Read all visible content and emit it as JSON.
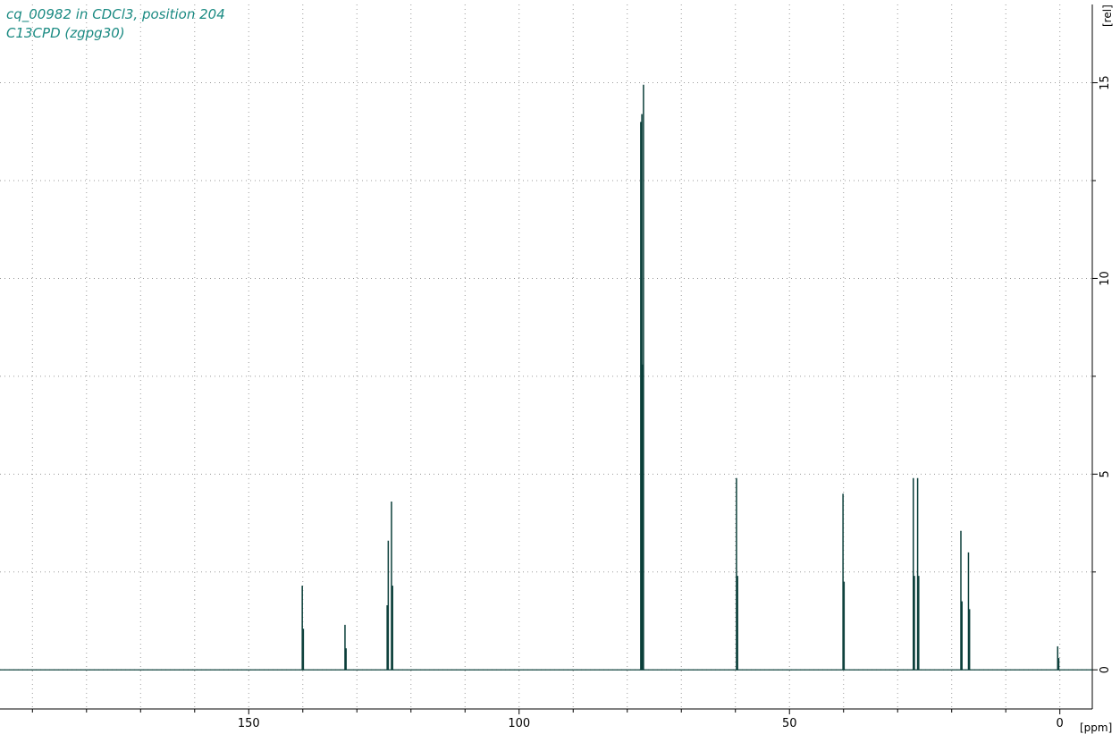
{
  "window": {
    "title_line1": "cq_00982 in CDCl3, position 204",
    "title_line2": "C13CPD (zgpg30)"
  },
  "colors": {
    "title": "#1a8a82",
    "spectrum": "#0b3f3a",
    "grid": "#9a9a9a",
    "background": "#ffffff"
  },
  "chart_data": {
    "type": "line",
    "title": "cq_00982 in CDCl3, position 204",
    "subtitle": "C13CPD (zgpg30)",
    "xlabel": "[ppm]",
    "ylabel": "[rel]",
    "x_reversed": true,
    "xlim": [
      196,
      -6
    ],
    "ylim": [
      -1,
      17
    ],
    "x_ticks": [
      150,
      100,
      50,
      0
    ],
    "y_ticks": [
      0,
      5,
      10,
      15
    ],
    "grid": true,
    "peaks": [
      {
        "ppm": 140.1,
        "height": 2.15
      },
      {
        "ppm": 139.9,
        "height": 1.05
      },
      {
        "ppm": 132.2,
        "height": 1.15
      },
      {
        "ppm": 132.0,
        "height": 0.55
      },
      {
        "ppm": 124.4,
        "height": 1.65
      },
      {
        "ppm": 124.2,
        "height": 3.3
      },
      {
        "ppm": 123.6,
        "height": 4.3
      },
      {
        "ppm": 123.4,
        "height": 2.15
      },
      {
        "ppm": 77.5,
        "height": 14.0
      },
      {
        "ppm": 77.3,
        "height": 14.2
      },
      {
        "ppm": 77.2,
        "height": 7.8
      },
      {
        "ppm": 77.0,
        "height": 14.95
      },
      {
        "ppm": 59.8,
        "height": 4.9
      },
      {
        "ppm": 59.6,
        "height": 2.4
      },
      {
        "ppm": 40.1,
        "height": 4.5
      },
      {
        "ppm": 39.9,
        "height": 2.25
      },
      {
        "ppm": 27.1,
        "height": 4.9
      },
      {
        "ppm": 26.9,
        "height": 2.4
      },
      {
        "ppm": 26.3,
        "height": 4.9
      },
      {
        "ppm": 26.1,
        "height": 2.4
      },
      {
        "ppm": 18.3,
        "height": 3.55
      },
      {
        "ppm": 18.1,
        "height": 1.75
      },
      {
        "ppm": 16.9,
        "height": 3.0
      },
      {
        "ppm": 16.7,
        "height": 1.55
      },
      {
        "ppm": 0.4,
        "height": 0.6
      },
      {
        "ppm": 0.2,
        "height": 0.3
      }
    ]
  }
}
